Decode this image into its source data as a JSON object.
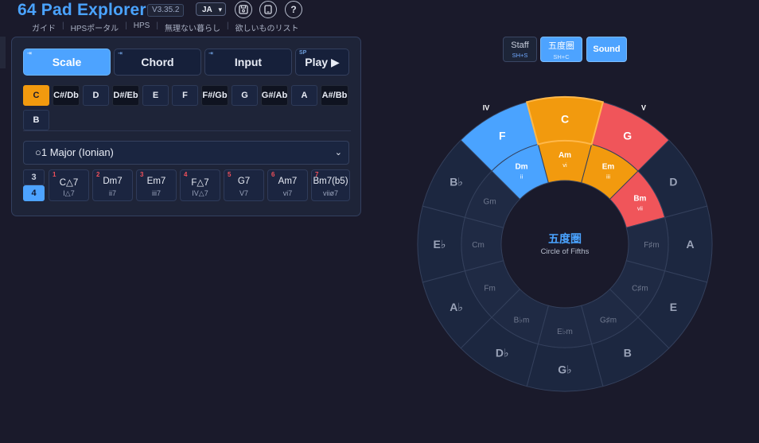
{
  "header": {
    "title": "64 Pad Explorer",
    "version": "V3.35.2",
    "language": "JA",
    "links": [
      "ガイド",
      "HPSポータル",
      "HPS",
      "無理ない暮らし",
      "欲しいものリスト"
    ],
    "icons": [
      "save-icon",
      "tablet-icon",
      "help-icon"
    ]
  },
  "modes": [
    {
      "label": "Scale",
      "shortcut": "⇥",
      "active": true
    },
    {
      "label": "Chord",
      "shortcut": "⇥",
      "active": false
    },
    {
      "label": "Input",
      "shortcut": "⇥",
      "active": false
    },
    {
      "label": "Play ▶",
      "shortcut": "SP",
      "active": false
    }
  ],
  "keys": [
    "C",
    "C#/Db",
    "D",
    "D#/Eb",
    "E",
    "F",
    "F#/Gb",
    "G",
    "G#/Ab",
    "A",
    "A#/Bb",
    "B"
  ],
  "selected_key": "C",
  "scale": {
    "selected": "○1 Major (Ionian)"
  },
  "note_count": {
    "options": [
      "3",
      "4"
    ],
    "selected": "4"
  },
  "chords": [
    {
      "num": "1",
      "name": "C△7",
      "degree": "I△7"
    },
    {
      "num": "2",
      "name": "Dm7",
      "degree": "ii7"
    },
    {
      "num": "3",
      "name": "Em7",
      "degree": "iii7"
    },
    {
      "num": "4",
      "name": "F△7",
      "degree": "IV△7"
    },
    {
      "num": "5",
      "name": "G7",
      "degree": "V7"
    },
    {
      "num": "6",
      "name": "Am7",
      "degree": "vi7"
    },
    {
      "num": "7",
      "name": "Bm7(b5)",
      "degree": "viiø7"
    }
  ],
  "view": {
    "staff": {
      "label": "Staff",
      "shortcut": "SH+S"
    },
    "circle": {
      "label": "五度圏",
      "shortcut": "SH+C"
    },
    "sound": {
      "label": "Sound"
    }
  },
  "circle": {
    "title": "五度圏",
    "subtitle": "Circle of Fifths",
    "major": [
      "C",
      "G",
      "D",
      "A",
      "E",
      "B",
      "G♭",
      "D♭",
      "A♭",
      "E♭",
      "B♭",
      "F"
    ],
    "minor": [
      "Am",
      "Em",
      "Bm",
      "F♯m",
      "C♯m",
      "G♯m",
      "E♭m",
      "B♭m",
      "Fm",
      "Cm",
      "Gm",
      "Dm"
    ],
    "major_degrees": [
      "I",
      "V",
      "",
      "",
      "",
      "",
      "",
      "",
      "",
      "",
      "",
      "IV"
    ],
    "minor_degrees": [
      "vi",
      "iii",
      "vii",
      "",
      "",
      "",
      "",
      "",
      "",
      "",
      "",
      "ii"
    ],
    "highlight": {
      "major": [
        "orange",
        "red",
        "none",
        "none",
        "none",
        "none",
        "none",
        "none",
        "none",
        "none",
        "none",
        "blue"
      ],
      "minor": [
        "orange",
        "orange",
        "red",
        "none",
        "none",
        "none",
        "none",
        "none",
        "none",
        "none",
        "none",
        "blue"
      ]
    },
    "colors": {
      "orange": "#f29a0e",
      "red": "#f0555a",
      "blue": "#4aa3ff",
      "none": "#1c2740",
      "inner_none": "#1f2a44",
      "stroke": "#34405c"
    }
  }
}
